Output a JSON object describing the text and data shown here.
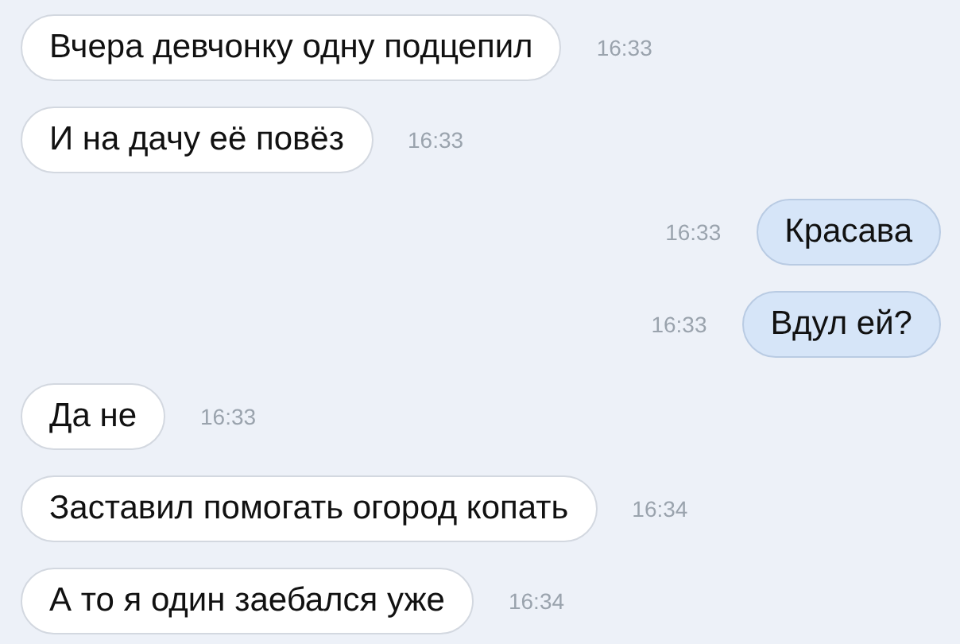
{
  "messages": [
    {
      "kind": "incoming",
      "text": "Вчера девчонку одну подцепил",
      "time": "16:33"
    },
    {
      "kind": "incoming",
      "text": "И на дачу её повёз",
      "time": "16:33"
    },
    {
      "kind": "outgoing",
      "text": "Красава",
      "time": "16:33"
    },
    {
      "kind": "outgoing",
      "text": "Вдул ей?",
      "time": "16:33"
    },
    {
      "kind": "incoming",
      "text": "Да не",
      "time": "16:33"
    },
    {
      "kind": "incoming",
      "text": "Заставил помогать огород копать",
      "time": "16:34"
    },
    {
      "kind": "incoming",
      "text": "А то я один заебался уже",
      "time": "16:34"
    }
  ]
}
